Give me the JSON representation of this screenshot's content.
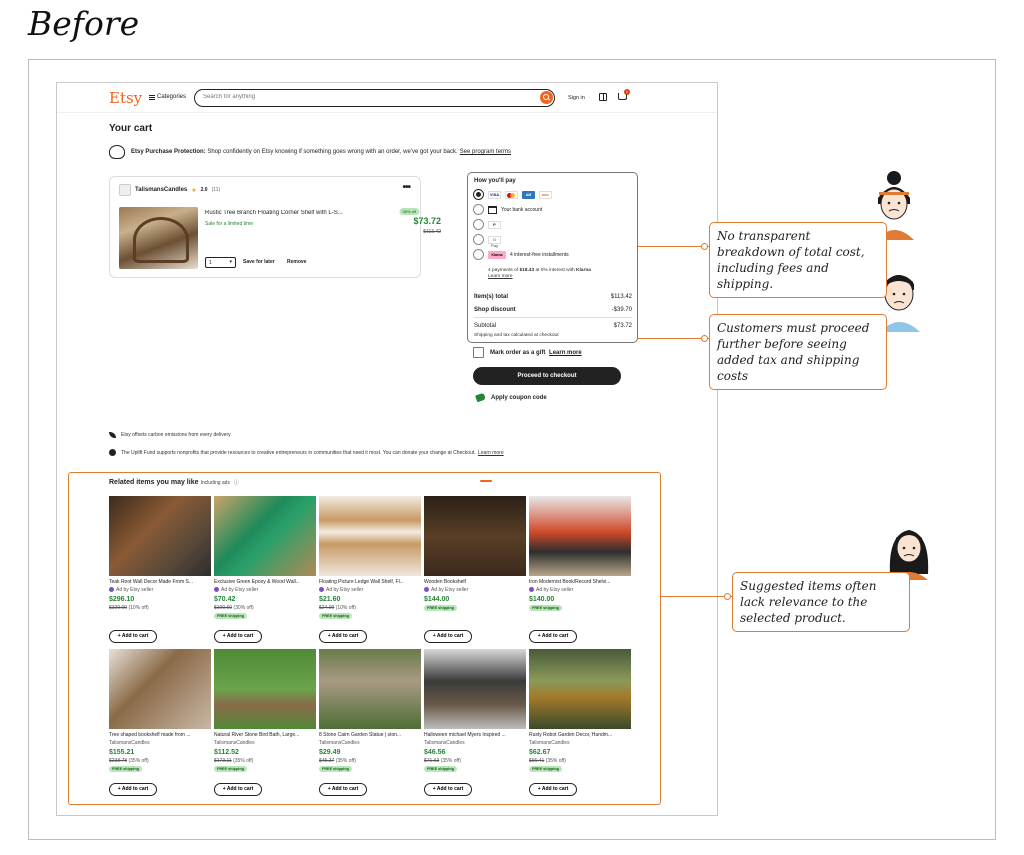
{
  "heading": "Before",
  "header": {
    "logo": "Etsy",
    "categories": "Categories",
    "search_placeholder": "Search for anything",
    "sign_in": "Sign in",
    "cart_count": "1"
  },
  "cart": {
    "title": "Your cart",
    "protection_bold": "Etsy Purchase Protection:",
    "protection_text": "Shop confidently on Etsy knowing if something goes wrong with an order, we've got your back.",
    "protection_link": "See program terms",
    "item": {
      "shop": "TalismansCandles",
      "rating": "2.0",
      "reviews": "(11)",
      "title": "Rustic Tree Branch Floating Corner Shelf with L-S...",
      "sale": "Sale for a limited time",
      "discount_badge": "35% off",
      "price": "$73.72",
      "old_price": "$113.42",
      "qty": "1",
      "save_later": "Save for later",
      "remove": "Remove"
    }
  },
  "payment": {
    "title": "How you'll pay",
    "bank": "Your bank account",
    "gpay": "G Pay",
    "klarna_label": "4 interest-free installments",
    "klarna_pre": "4 payments of ",
    "klarna_amount": "$18.43",
    "klarna_post": " at 0% interest with ",
    "klarna_brand": "Klarna",
    "learn_more": "Learn more",
    "items_total_label": "Item(s) total",
    "items_total": "$113.42",
    "shop_discount_label": "Shop discount",
    "shop_discount": "-$39.70",
    "subtotal_label": "Subtotal",
    "subtotal": "$73.72",
    "shipping_note": "Shipping and tax calculated at checkout",
    "gift_label": "Mark order as a gift",
    "gift_link": "Learn more",
    "checkout": "Proceed to checkout",
    "coupon": "Apply coupon code"
  },
  "footer_notes": {
    "carbon": "Etsy offsets carbon emissions from every delivery",
    "uplift": "The Uplift Fund supports nonprofits that provide resources to creative entrepreneurs in communities that need it most. You can donate your change at Checkout.",
    "uplift_link": "Learn more"
  },
  "related": {
    "title": "Related items you may like",
    "ads_note": "Including ads",
    "add_to_cart": "+ Add to cart",
    "free_shipping": "FREE shipping",
    "items": [
      {
        "title": "Teak Root Wall Decor Made From S...",
        "sub": "Ad by Etsy seller",
        "price": "$296.10",
        "old": "$329.00",
        "pct": "(10% off)",
        "free": false
      },
      {
        "title": "Exclusive Green Epoxy & Wood Wall...",
        "sub": "Ad by Etsy seller",
        "price": "$70.42",
        "old": "$100.60",
        "pct": "(30% off)",
        "free": true
      },
      {
        "title": "Floating Picture Ledge Wall Shelf, Fl...",
        "sub": "Ad by Etsy seller",
        "price": "$21.60",
        "old": "$24.00",
        "pct": "(10% off)",
        "free": true
      },
      {
        "title": "Wooden Bookshelf",
        "sub": "Ad by Etsy seller",
        "price": "$144.00",
        "old": "",
        "pct": "",
        "free": true
      },
      {
        "title": "Iron Modernist Book/Record Shelvi...",
        "sub": "Ad by Etsy seller",
        "price": "$140.00",
        "old": "",
        "pct": "",
        "free": true
      },
      {
        "title": "Tree shaped bookshelf made from ...",
        "sub": "TalismansCandles",
        "price": "$155.21",
        "old": "$238.78",
        "pct": "(35% off)",
        "free": true
      },
      {
        "title": "Natural River Stone Bird Bath, Large...",
        "sub": "TalismansCandles",
        "price": "$112.52",
        "old": "$173.11",
        "pct": "(35% off)",
        "free": true
      },
      {
        "title": "8 Stone Cairn Garden Statue | ston...",
        "sub": "TalismansCandles",
        "price": "$29.49",
        "old": "$45.37",
        "pct": "(35% off)",
        "free": true
      },
      {
        "title": "Halloween michael Myers Inspired ...",
        "sub": "TalismansCandles",
        "price": "$46.56",
        "old": "$71.63",
        "pct": "(35% off)",
        "free": true
      },
      {
        "title": "Rusty Robot Garden Decor, Handm...",
        "sub": "TalismansCandles",
        "price": "$62.67",
        "old": "$96.41",
        "pct": "(35% off)",
        "free": true
      }
    ]
  },
  "annotations": [
    "No transparent breakdown of total cost, including fees and shipping.",
    "Customers must proceed further before seeing added tax and shipping costs",
    "Suggested items often lack relevance to the selected product."
  ],
  "colors": {
    "accent": "#e07b34",
    "etsy_orange": "#f1641e",
    "price_green": "#258635"
  }
}
